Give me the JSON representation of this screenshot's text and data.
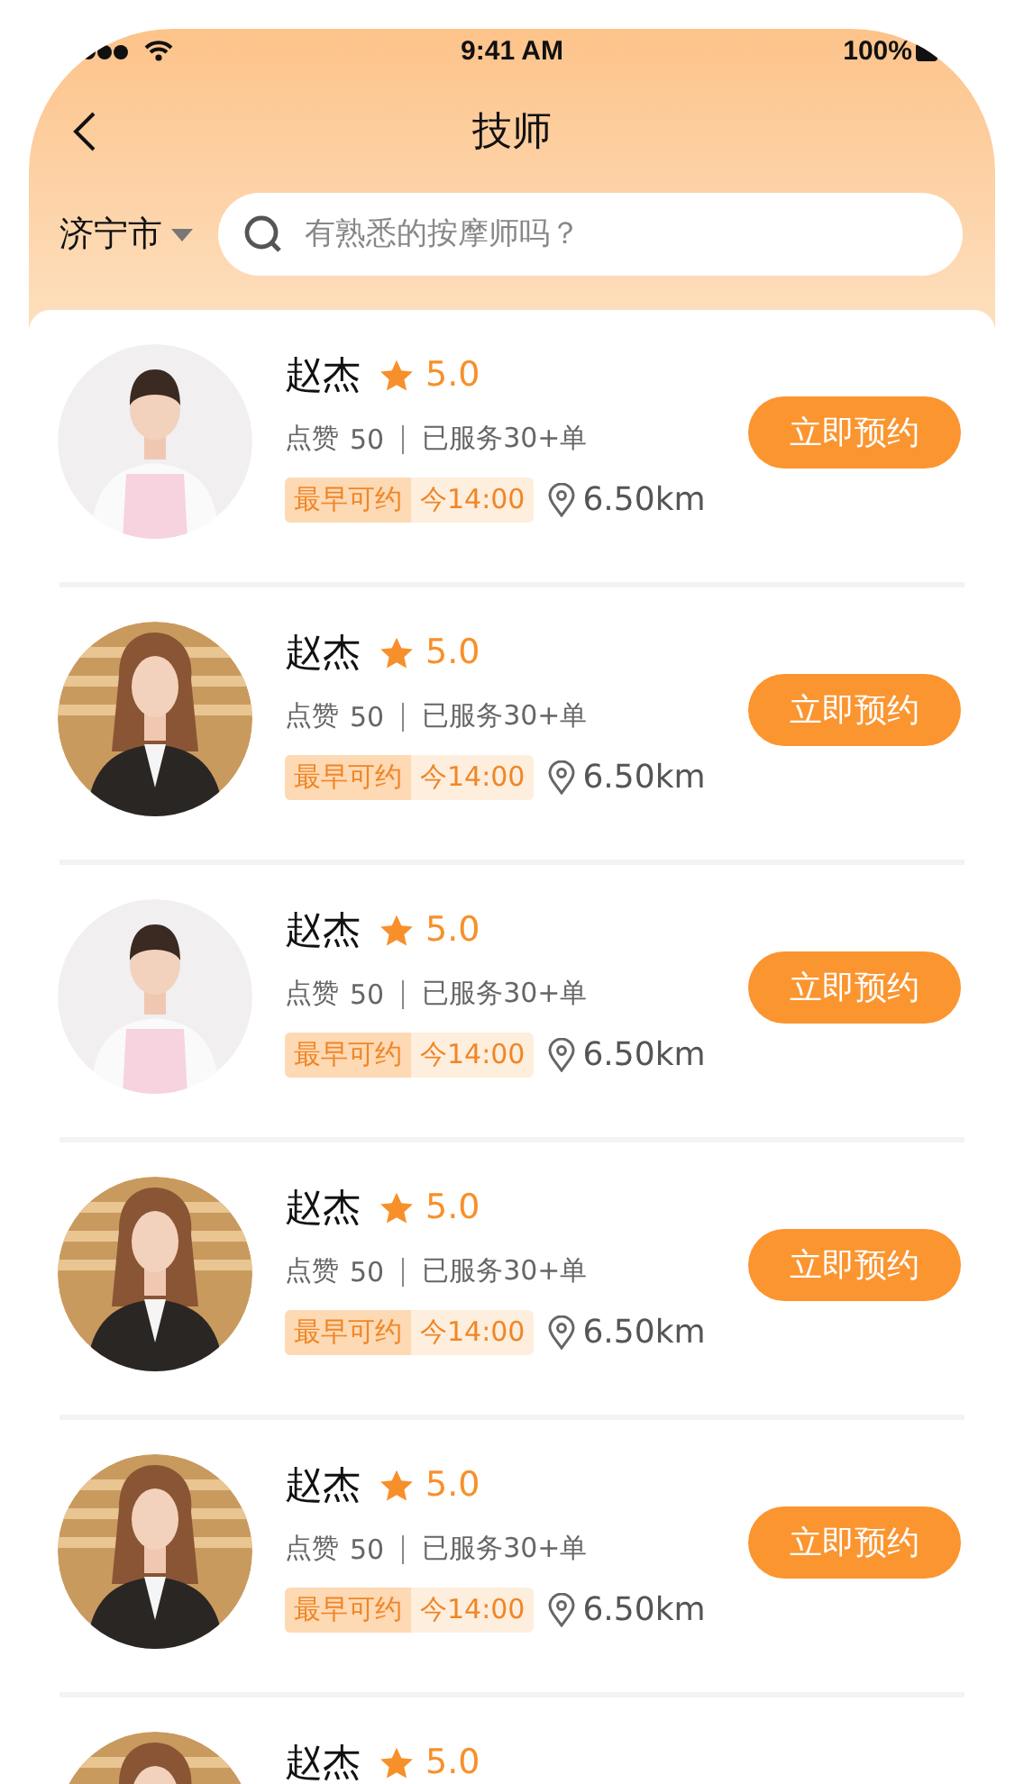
{
  "status_bar": {
    "time": "9:41 AM",
    "battery": "100%"
  },
  "header": {
    "title": "技师",
    "city": "济宁市",
    "search": {
      "placeholder": "有熟悉的按摩师吗？"
    }
  },
  "therapists": [
    {
      "name": "赵杰",
      "rating": "5.0",
      "likes_label": "点赞",
      "likes": "50",
      "served": "已服务30+单",
      "tag_label": "最早可约",
      "tag_time": "今14:00",
      "distance": "6.50km",
      "button": "立即预约"
    },
    {
      "name": "赵杰",
      "rating": "5.0",
      "likes_label": "点赞",
      "likes": "50",
      "served": "已服务30+单",
      "tag_label": "最早可约",
      "tag_time": "今14:00",
      "distance": "6.50km",
      "button": "立即预约"
    },
    {
      "name": "赵杰",
      "rating": "5.0",
      "likes_label": "点赞",
      "likes": "50",
      "served": "已服务30+单",
      "tag_label": "最早可约",
      "tag_time": "今14:00",
      "distance": "6.50km",
      "button": "立即预约"
    },
    {
      "name": "赵杰",
      "rating": "5.0",
      "likes_label": "点赞",
      "likes": "50",
      "served": "已服务30+单",
      "tag_label": "最早可约",
      "tag_time": "今14:00",
      "distance": "6.50km",
      "button": "立即预约"
    },
    {
      "name": "赵杰",
      "rating": "5.0",
      "likes_label": "点赞",
      "likes": "50",
      "served": "已服务30+单",
      "tag_label": "最早可约",
      "tag_time": "今14:00",
      "distance": "6.50km",
      "button": "立即预约"
    },
    {
      "name": "赵杰",
      "rating": "5.0"
    }
  ]
}
